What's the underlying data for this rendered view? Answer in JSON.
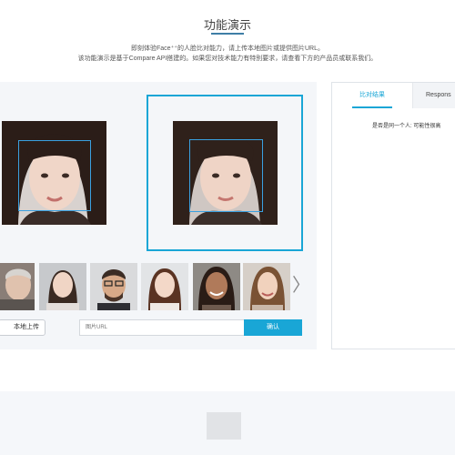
{
  "header": {
    "title": "功能演示",
    "desc_line1": "即刻体验Face⁺⁺的人脸比对能力，请上传本地图片或提供图片URL。",
    "desc_line2": "该功能演示是基于Compare API搭建的。如果您对技术能力有特别要求，请查看下方的产品员或联系我们。"
  },
  "demo": {
    "upload_label": "本地上传",
    "url_placeholder": "图片URL",
    "confirm_label": "确认",
    "next_icon": "chevron-right-icon",
    "next_glyph": "〉"
  },
  "result": {
    "tabs": [
      "比对结果",
      "Respons"
    ],
    "active_tab": "比对结果",
    "text": "是否是同一个人: 可能性很高"
  },
  "colors": {
    "accent": "#19a6d6",
    "face_box": "#3aa0e0",
    "panel_bg": "#f4f6f9"
  }
}
